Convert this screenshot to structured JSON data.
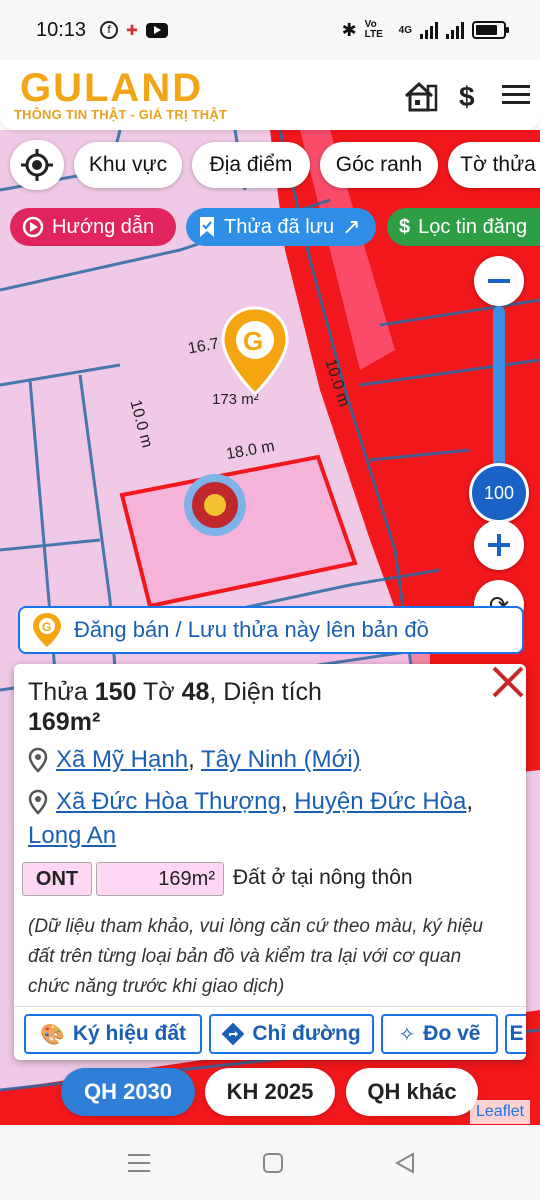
{
  "status_bar": {
    "time": "10:13",
    "network_label": "Vo LTE",
    "network_type": "4G"
  },
  "header": {
    "logo": "GULAND",
    "tagline": "THÔNG TIN THẬT - GIÁ TRỊ THẬT",
    "icons": [
      "building-icon",
      "dollar-icon",
      "menu-icon"
    ]
  },
  "toolbar": {
    "chips": [
      "Khu vực",
      "Địa điểm",
      "Góc ranh",
      "Tờ thửa"
    ]
  },
  "pills": {
    "guide": "Hướng dẫn",
    "saved": "Thửa đã lưu",
    "filter": "Lọc tin đăng"
  },
  "map": {
    "lot_top": "16.7",
    "lot_right": "10.0 m",
    "lot_left": "10.0 m",
    "lot_bottom": "18.0 m",
    "lot_area": "173 m²",
    "zoom_level": "100"
  },
  "post_banner": "Đăng bán / Lưu thửa này lên bản đồ",
  "parcel": {
    "title_prefix": "Thửa ",
    "parcel_no": "150",
    "title_mid": " Tờ ",
    "sheet_no": "48",
    "title_suffix": ", Diện tích",
    "area": "169m²",
    "addr1_part1": "Xã Mỹ Hạnh",
    "addr1_part2": "Tây Ninh (Mới)",
    "addr2_part1": "Xã Đức Hòa Thượng",
    "addr2_part2": "Huyện Đức Hòa",
    "addr2_part3": "Long An",
    "land_code": "ONT",
    "land_area": "169m²",
    "land_type": "Đất ở tại nông thôn",
    "note": "(Dữ liệu tham khảo, vui lòng căn cứ theo màu, ký hiệu đất trên từng loại bản đồ và kiểm tra lại với cơ quan chức năng trước khi giao dịch)"
  },
  "actions": {
    "symbols": "Ký hiệu đất",
    "directions": "Chỉ đường",
    "measure": "Đo vẽ"
  },
  "tabs": {
    "qh2030": "QH 2030",
    "kh2025": "KH 2025",
    "qh_other": "QH khác"
  },
  "attribution": "Leaflet",
  "colors": {
    "accent_blue": "#1a73e8",
    "brand_orange": "#f2a516",
    "pink_zone": "#f0c9e6",
    "red_zone": "#f2171b",
    "guide_pill": "#e0245e",
    "filter_pill": "#2e9e44"
  }
}
